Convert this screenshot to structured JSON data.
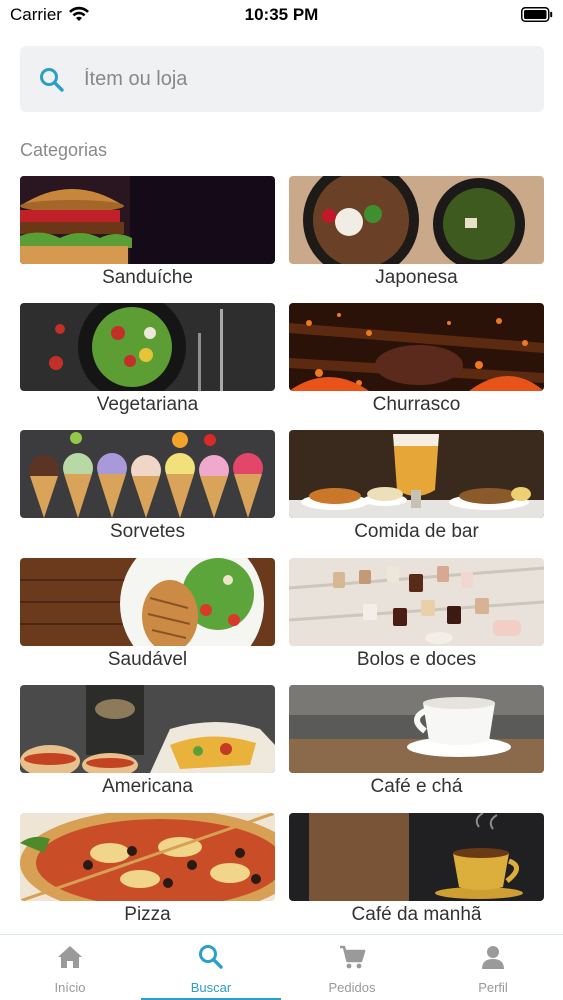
{
  "status_bar": {
    "carrier": "Carrier",
    "time": "10:35 PM"
  },
  "search": {
    "placeholder": "Ítem ou loja"
  },
  "categories": {
    "title": "Categorias",
    "items": [
      {
        "label": "Sanduíche"
      },
      {
        "label": "Japonesa"
      },
      {
        "label": "Vegetariana"
      },
      {
        "label": "Churrasco"
      },
      {
        "label": "Sorvetes"
      },
      {
        "label": "Comida de bar"
      },
      {
        "label": "Saudável"
      },
      {
        "label": "Bolos e doces"
      },
      {
        "label": "Americana"
      },
      {
        "label": "Café e chá"
      },
      {
        "label": "Pizza"
      },
      {
        "label": "Café da manhã"
      }
    ]
  },
  "tab_bar": {
    "accent_color": "#2a9fc8",
    "tabs": [
      {
        "label": "Início",
        "icon": "home-icon",
        "active": false
      },
      {
        "label": "Buscar",
        "icon": "search-icon",
        "active": true
      },
      {
        "label": "Pedidos",
        "icon": "cart-icon",
        "active": false
      },
      {
        "label": "Perfil",
        "icon": "person-icon",
        "active": false
      }
    ]
  }
}
